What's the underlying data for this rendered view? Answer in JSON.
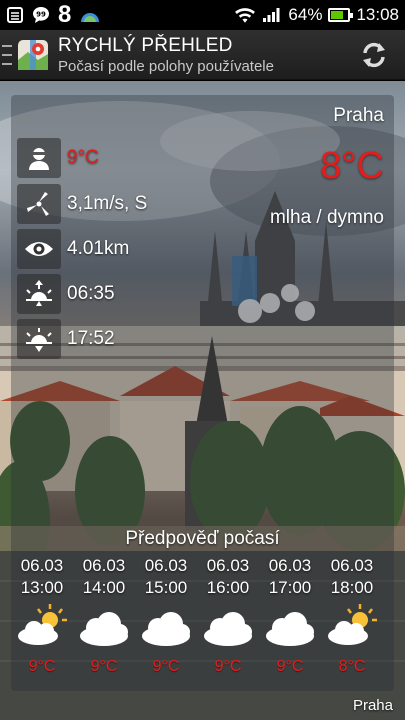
{
  "status_bar": {
    "badge_number": "8",
    "battery_text": "64%",
    "battery_level": 0.64,
    "time": "13:08",
    "icons": [
      "calendar-icon",
      "chat-bubble-icon",
      "weather-app-icon",
      "wifi-icon",
      "signal-icon",
      "battery-icon"
    ]
  },
  "app_bar": {
    "title": "RYCHLÝ PŘEHLED",
    "subtitle": "Počasí podle polohy používatele",
    "refresh_icon": "refresh-icon"
  },
  "current": {
    "city": "Praha",
    "temperature": "8°C",
    "condition": "mlha / dymno",
    "details": [
      {
        "icon": "person-icon",
        "text": "9°C",
        "highlight": true
      },
      {
        "icon": "wind-icon",
        "text": "3,1m/s, S",
        "highlight": false
      },
      {
        "icon": "eye-icon",
        "text": "4.01km",
        "highlight": false
      },
      {
        "icon": "sunrise-icon",
        "text": "06:35",
        "highlight": false
      },
      {
        "icon": "sunset-icon",
        "text": "17:52",
        "highlight": false
      }
    ]
  },
  "forecast": {
    "title": "Předpověď počasí",
    "items": [
      {
        "date": "06.03",
        "time": "13:00",
        "icon": "partly-sunny-icon",
        "temp": "9°C"
      },
      {
        "date": "06.03",
        "time": "14:00",
        "icon": "cloud-icon",
        "temp": "9°C"
      },
      {
        "date": "06.03",
        "time": "15:00",
        "icon": "cloud-icon",
        "temp": "9°C"
      },
      {
        "date": "06.03",
        "time": "16:00",
        "icon": "cloud-icon",
        "temp": "9°C"
      },
      {
        "date": "06.03",
        "time": "17:00",
        "icon": "cloud-icon",
        "temp": "9°C"
      },
      {
        "date": "06.03",
        "time": "18:00",
        "icon": "partly-sunny-icon",
        "temp": "8°C"
      }
    ]
  },
  "footer": {
    "city": "Praha"
  },
  "colors": {
    "temperature_red": "#e41c1c",
    "battery_green": "#5fc700"
  }
}
